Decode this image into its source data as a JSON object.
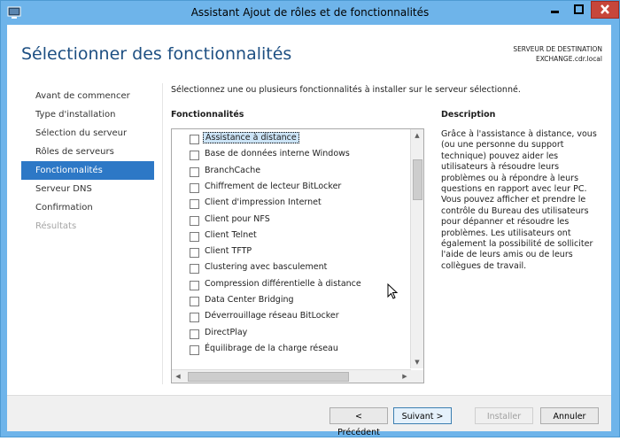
{
  "window": {
    "title": "Assistant Ajout de rôles et de fonctionnalités",
    "controls": {
      "minimize": "minimize",
      "maximize": "maximize",
      "close": "close"
    }
  },
  "header": {
    "page_title": "Sélectionner des fonctionnalités",
    "destination_label": "SERVEUR DE DESTINATION",
    "destination_server": "EXCHANGE.cdr.local"
  },
  "nav": {
    "items": [
      {
        "label": "Avant de commencer",
        "state": "normal"
      },
      {
        "label": "Type d'installation",
        "state": "normal"
      },
      {
        "label": "Sélection du serveur",
        "state": "normal"
      },
      {
        "label": "Rôles de serveurs",
        "state": "normal"
      },
      {
        "label": "Fonctionnalités",
        "state": "active"
      },
      {
        "label": "Serveur DNS",
        "state": "normal"
      },
      {
        "label": "Confirmation",
        "state": "normal"
      },
      {
        "label": "Résultats",
        "state": "disabled"
      }
    ]
  },
  "main": {
    "instruction": "Sélectionnez une ou plusieurs fonctionnalités à installer sur le serveur sélectionné.",
    "features_heading": "Fonctionnalités",
    "features": [
      "Assistance à distance",
      "Base de données interne Windows",
      "BranchCache",
      "Chiffrement de lecteur BitLocker",
      "Client d'impression Internet",
      "Client pour NFS",
      "Client Telnet",
      "Client TFTP",
      "Clustering avec basculement",
      "Compression différentielle à distance",
      "Data Center Bridging",
      "Déverrouillage réseau BitLocker",
      "DirectPlay",
      "Équilibrage de la charge réseau"
    ],
    "selected_feature_index": 0,
    "description_heading": "Description",
    "description_text": "Grâce à l'assistance à distance, vous (ou une personne du support technique) pouvez aider les utilisateurs à résoudre leurs problèmes ou à répondre à leurs questions en rapport avec leur PC. Vous pouvez afficher et prendre le contrôle du Bureau des utilisateurs pour dépanner et résoudre les problèmes. Les utilisateurs ont également la possibilité de solliciter l'aide de leurs amis ou de leurs collègues de travail."
  },
  "footer": {
    "previous_label": "< Précédent",
    "next_label": "Suivant >",
    "install_label": "Installer",
    "cancel_label": "Annuler"
  },
  "colors": {
    "titlebar": "#6eb4ea",
    "nav_active": "#2d78c6",
    "page_title": "#1d4f82",
    "close_button": "#c7463a"
  }
}
